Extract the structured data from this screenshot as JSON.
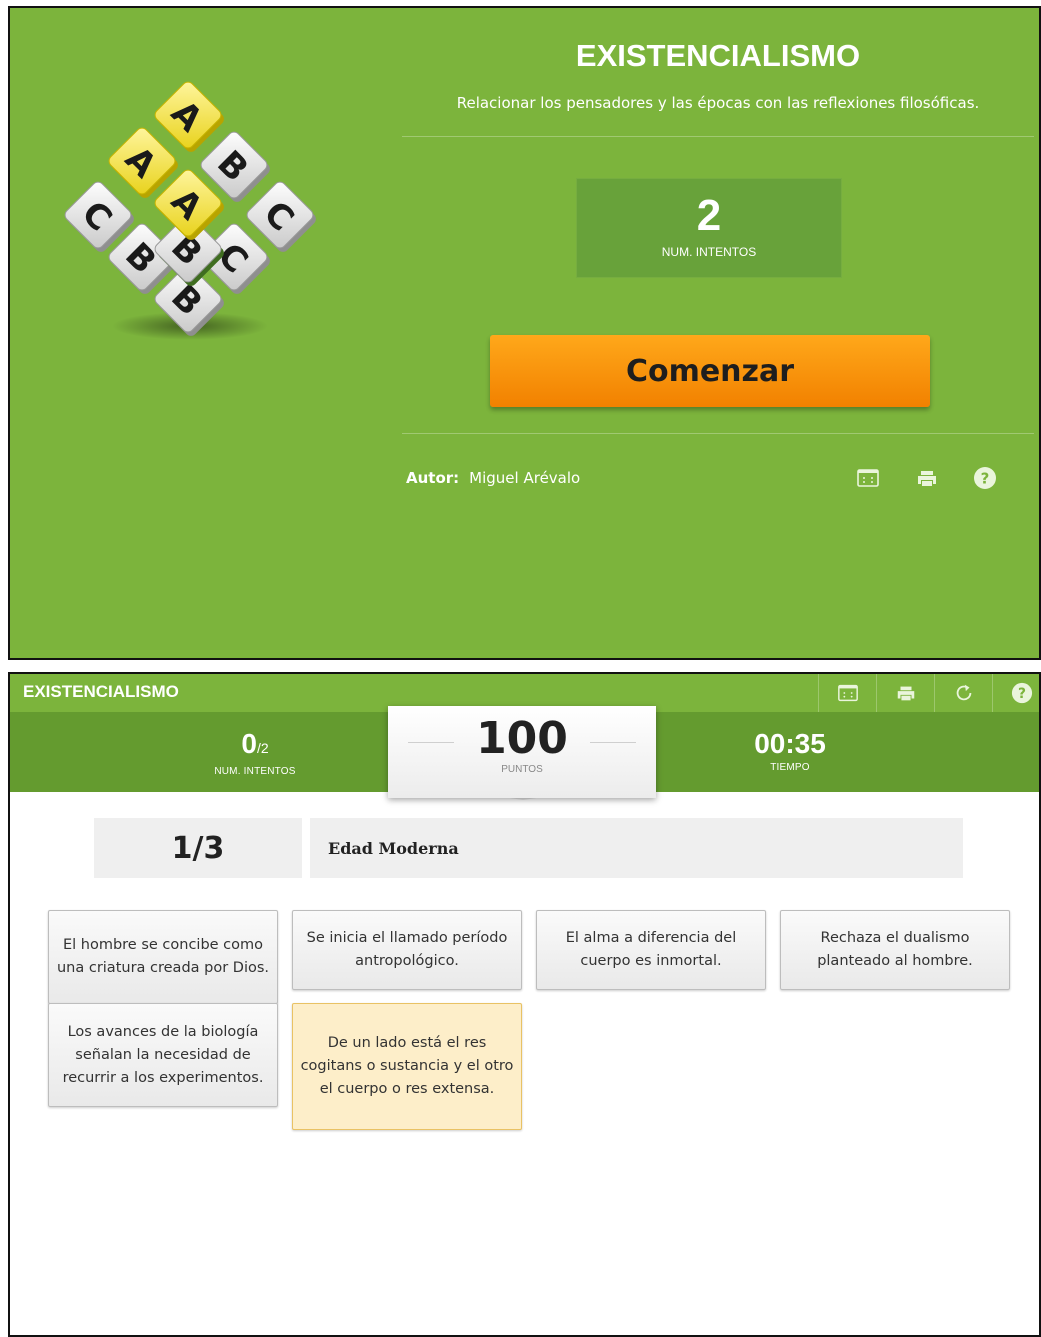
{
  "intro": {
    "title": "EXISTENCIALISMO",
    "subtitle": "Relacionar los pensadores y las épocas con las reflexiones filosóficas.",
    "attempts_value": "2",
    "attempts_label": "NUM. INTENTOS",
    "start_label": "Comenzar",
    "author_label": "Autor:",
    "author_name": "Miguel Arévalo",
    "icons": [
      "fullscreen-icon",
      "print-icon",
      "help-icon"
    ],
    "logo_letters": [
      "A",
      "A",
      "B",
      "C",
      "C",
      "A",
      "B",
      "C",
      "B",
      "B"
    ]
  },
  "game": {
    "title": "EXISTENCIALISMO",
    "header_icons": [
      "fullscreen-icon",
      "print-icon",
      "restart-icon",
      "help-icon"
    ],
    "attempts": {
      "value": "0",
      "of": "/2",
      "label": "NUM. INTENTOS"
    },
    "score": {
      "value": "100",
      "label": "PUNTOS"
    },
    "time": {
      "value": "00:35",
      "label": "TIEMPO"
    },
    "progress": "1/3",
    "era": "Edad Moderna",
    "cards": [
      {
        "text": "El hombre se concibe como una criatura creada por Dios.",
        "selected": false
      },
      {
        "text": "Se inicia el llamado período antropológico.",
        "selected": false
      },
      {
        "text": "El alma a diferencia del cuerpo es inmortal.",
        "selected": false
      },
      {
        "text": "Rechaza el dualismo planteado al hombre.",
        "selected": false
      },
      {
        "text": "Los avances de la biología señalan la necesidad de recurrir a los experimentos.",
        "selected": false
      },
      {
        "text": "De un lado está el res cogitans o sustancia y el otro el cuerpo o res extensa.",
        "selected": true
      }
    ]
  },
  "colors": {
    "green": "#7cb43c",
    "green_dark": "#649b2f",
    "orange": "#f28100",
    "selected_card": "#fdeec9"
  }
}
